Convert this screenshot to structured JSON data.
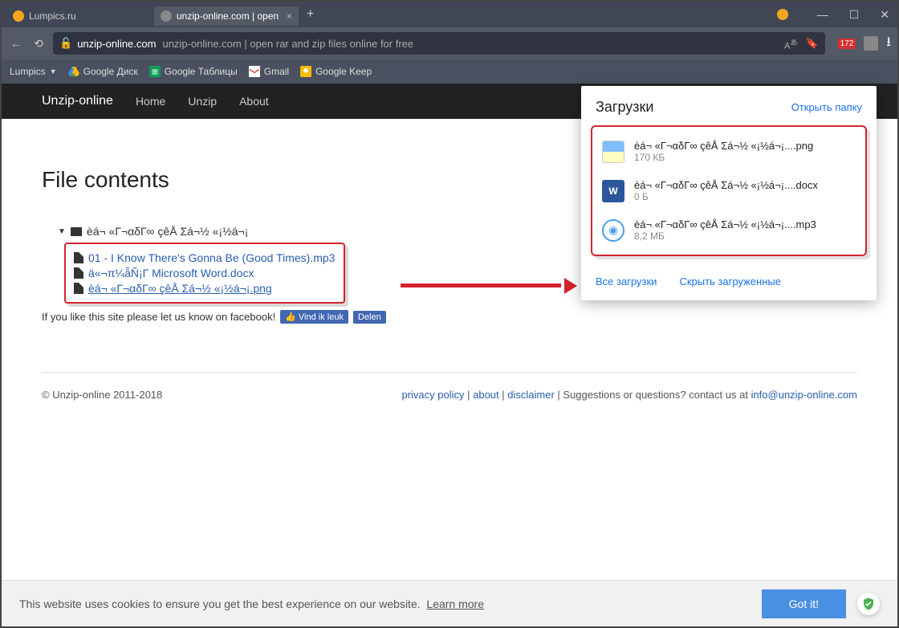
{
  "tabs": [
    {
      "label": "Lumpics.ru",
      "active": false
    },
    {
      "label": "unzip-online.com | open",
      "active": true
    }
  ],
  "address": {
    "host": "unzip-online.com",
    "title": "unzip-online.com | open rar and zip files online for free",
    "badge": "172"
  },
  "bookmarks": {
    "items": [
      "Lumpics",
      "Google Диск",
      "Google Таблицы",
      "Gmail",
      "Google Keep"
    ]
  },
  "siteNav": {
    "brand": "Unzip-online",
    "links": [
      "Home",
      "Unzip",
      "About"
    ]
  },
  "page": {
    "heading": "File contents",
    "folder": "èá¬ «Г¬αδГ∞ çêÅ Σá¬½ «¡½á¬¡",
    "files": [
      "01 - I Know There's Gonna Be (Good Times).mp3",
      "ä«¬π¼ẫÑ¡Г Microsoft Word.docx",
      "èá¬ «Г¬αδГ∞ çêÅ Σá¬½ «¡½á¬¡.png"
    ],
    "fbText": "If you like this site please let us know on facebook!",
    "fbLike": "Vind ik leuk",
    "fbShare": "Delen"
  },
  "footer": {
    "copyright": "© Unzip-online 2011-2018",
    "privacy": "privacy policy",
    "about": "about",
    "disclaimer": "disclaimer",
    "suggest": "Suggestions or questions? contact us at",
    "email": "info@unzip-online.com",
    "sep": " | "
  },
  "downloads": {
    "title": "Загрузки",
    "openFolder": "Открыть папку",
    "items": [
      {
        "name": "èá¬ «Г¬αδГ∞ çêÅ Σá¬½ «¡½á¬¡....png",
        "size": "170 КБ",
        "type": "img"
      },
      {
        "name": "èá¬ «Г¬αδГ∞ çêÅ Σá¬½ «¡½á¬¡....docx",
        "size": "0 Б",
        "type": "doc"
      },
      {
        "name": "èá¬ «Г¬αδГ∞ çêÅ Σá¬½ «¡½á¬¡....mp3",
        "size": "8,2 МБ",
        "type": "mp3"
      }
    ],
    "all": "Все загрузки",
    "hide": "Скрыть загруженные"
  },
  "cookie": {
    "text": "This website uses cookies to ensure you get the best experience on our website.",
    "learn": "Learn more",
    "btn": "Got it!"
  }
}
